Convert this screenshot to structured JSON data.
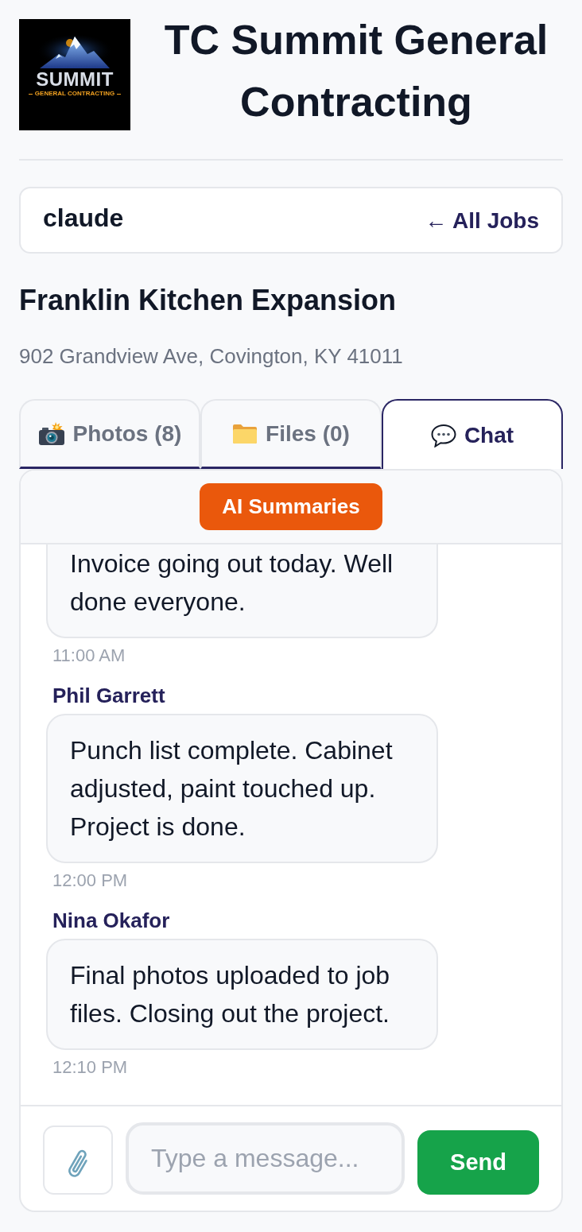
{
  "company": {
    "logo": {
      "wordmark": "SUMMIT",
      "tagline": "GENERAL CONTRACTING"
    },
    "name": "TC Summit General Contracting"
  },
  "user_bar": {
    "username": "claude",
    "back_link": "← All Jobs"
  },
  "job": {
    "title": "Franklin Kitchen Expansion",
    "address": "902 Grandview Ave, Covington, KY 41011"
  },
  "tabs": [
    {
      "kind": "photos",
      "label": "Photos (8)",
      "selected": false
    },
    {
      "kind": "files",
      "label": "Files (0)",
      "selected": false
    },
    {
      "kind": "chat",
      "label": "Chat",
      "selected": true
    }
  ],
  "chat": {
    "summary_button": "AI Summaries",
    "messages": [
      {
        "text": "Invoice going out today. Well done everyone.",
        "time": "11:00 AM",
        "cut_off": true
      },
      {
        "sender": "Phil Garrett",
        "text": "Punch list complete. Cabinet adjusted, paint touched up. Project is done.",
        "time": "12:00 PM",
        "cut_off": false
      },
      {
        "sender": "Nina Okafor",
        "text": "Final photos uploaded to job files. Closing out the project.",
        "time": "12:10 PM",
        "cut_off": false
      }
    ],
    "composer": {
      "placeholder": "Type a message...",
      "send_button": "Send"
    }
  }
}
